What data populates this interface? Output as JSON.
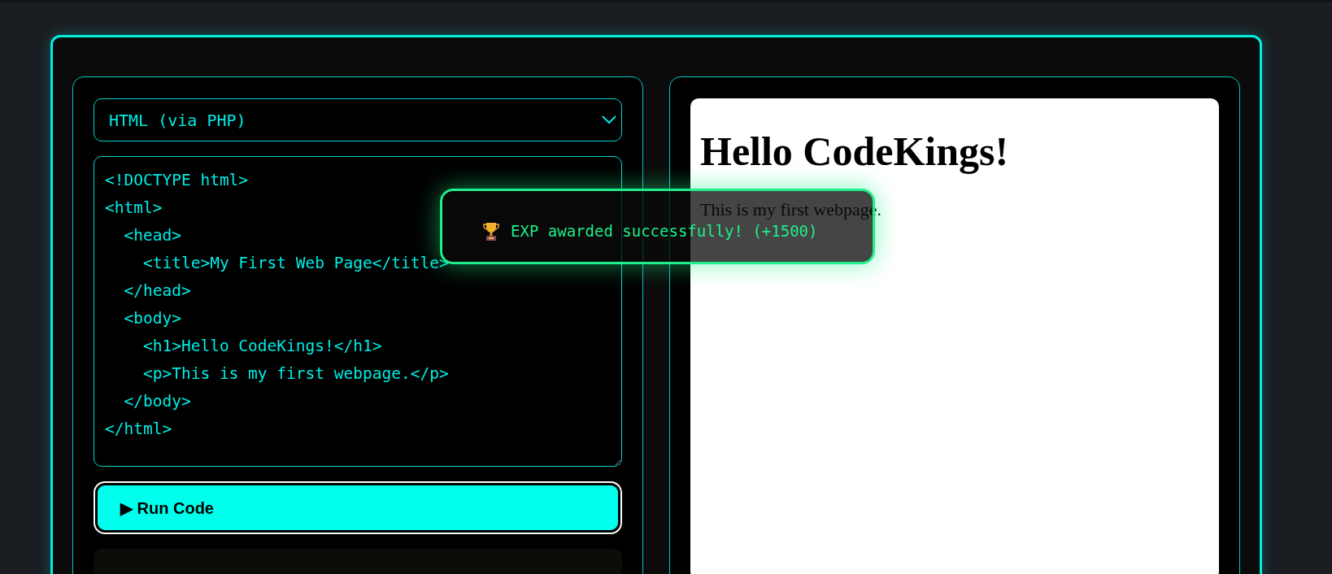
{
  "language_select": {
    "value": "HTML (via PHP)"
  },
  "editor": {
    "code": [
      "<!DOCTYPE html>",
      "<html>",
      "  <head>",
      "    <title>My First Web Page</title>",
      "  </head>",
      "  <body>",
      "    <h1>Hello CodeKings!</h1>",
      "    <p>This is my first webpage.</p>",
      "  </body>",
      "</html>"
    ]
  },
  "run_button": {
    "icon": "▶",
    "label": "Run Code"
  },
  "preview": {
    "heading": "Hello CodeKings!",
    "paragraph": "This is my first webpage."
  },
  "toast": {
    "message": "EXP awarded successfully! (+1500)"
  }
}
